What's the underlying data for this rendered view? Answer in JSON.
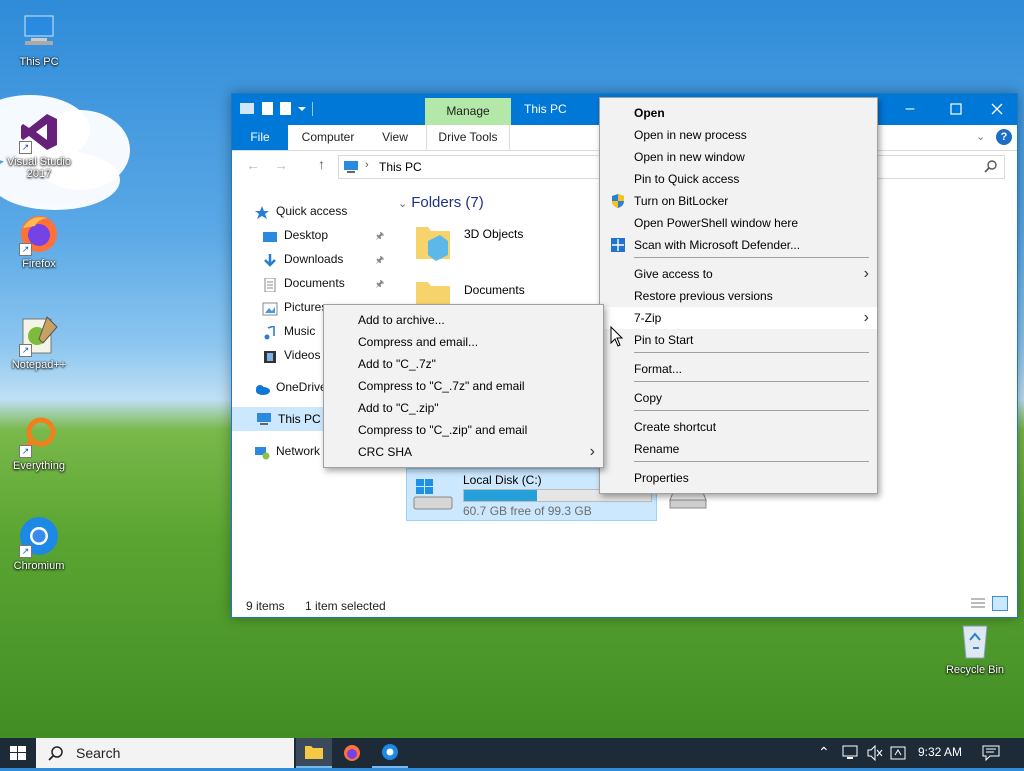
{
  "desktop": {
    "icons": [
      {
        "label": "This PC"
      },
      {
        "label": "Visual Studio 2017"
      },
      {
        "label": "Firefox"
      },
      {
        "label": "Notepad++"
      },
      {
        "label": "Everything"
      },
      {
        "label": "Chromium"
      },
      {
        "label": "Recycle Bin"
      }
    ]
  },
  "explorer": {
    "title": "This PC",
    "manage_tab": "Manage",
    "ribbon_tabs": [
      "File",
      "Computer",
      "View",
      "Drive Tools"
    ],
    "address": "This PC",
    "help_glyph": "?",
    "nav": [
      {
        "label": "Quick access"
      },
      {
        "label": "Desktop"
      },
      {
        "label": "Downloads"
      },
      {
        "label": "Documents"
      },
      {
        "label": "Pictures"
      },
      {
        "label": "Music"
      },
      {
        "label": "Videos"
      },
      {
        "label": "OneDrive"
      },
      {
        "label": "This PC"
      },
      {
        "label": "Network"
      }
    ],
    "folders_header": "Folders (7)",
    "folders": [
      {
        "label": "3D Objects"
      },
      {
        "label": "Documents"
      }
    ],
    "drive": {
      "label": "Local Disk (C:)",
      "free_text": "60.7 GB free of 99.3 GB",
      "used_fraction": 0.39
    },
    "status": {
      "items": "9 items",
      "selected": "1 item selected"
    }
  },
  "context_menu": {
    "items": [
      {
        "label": "Open",
        "bold": true
      },
      {
        "label": "Open in new process"
      },
      {
        "label": "Open in new window"
      },
      {
        "label": "Pin to Quick access"
      },
      {
        "label": "Turn on BitLocker",
        "icon": "shield-icon"
      },
      {
        "label": "Open PowerShell window here"
      },
      {
        "label": "Scan with Microsoft Defender...",
        "icon": "defender-icon"
      },
      {
        "label": "Give access to",
        "submenu": true
      },
      {
        "label": "Restore previous versions"
      },
      {
        "label": "7-Zip",
        "submenu": true,
        "highlight": true
      },
      {
        "label": "Pin to Start"
      },
      {
        "label": "Format..."
      },
      {
        "label": "Copy"
      },
      {
        "label": "Create shortcut"
      },
      {
        "label": "Rename"
      },
      {
        "label": "Properties"
      }
    ]
  },
  "zip_menu": {
    "items": [
      {
        "label": "Add to archive..."
      },
      {
        "label": "Compress and email..."
      },
      {
        "label": "Add to \"C_.7z\""
      },
      {
        "label": "Compress to \"C_.7z\" and email"
      },
      {
        "label": "Add to \"C_.zip\""
      },
      {
        "label": "Compress to \"C_.zip\" and email"
      },
      {
        "label": "CRC SHA",
        "submenu": true
      }
    ]
  },
  "taskbar": {
    "search_label": "Search",
    "clock": "9:32 AM"
  },
  "colors": {
    "titlebar": "#0078d7",
    "selection": "#cce8ff",
    "menu_bg": "#f2f2f2",
    "taskbar": "#1d2a38"
  }
}
